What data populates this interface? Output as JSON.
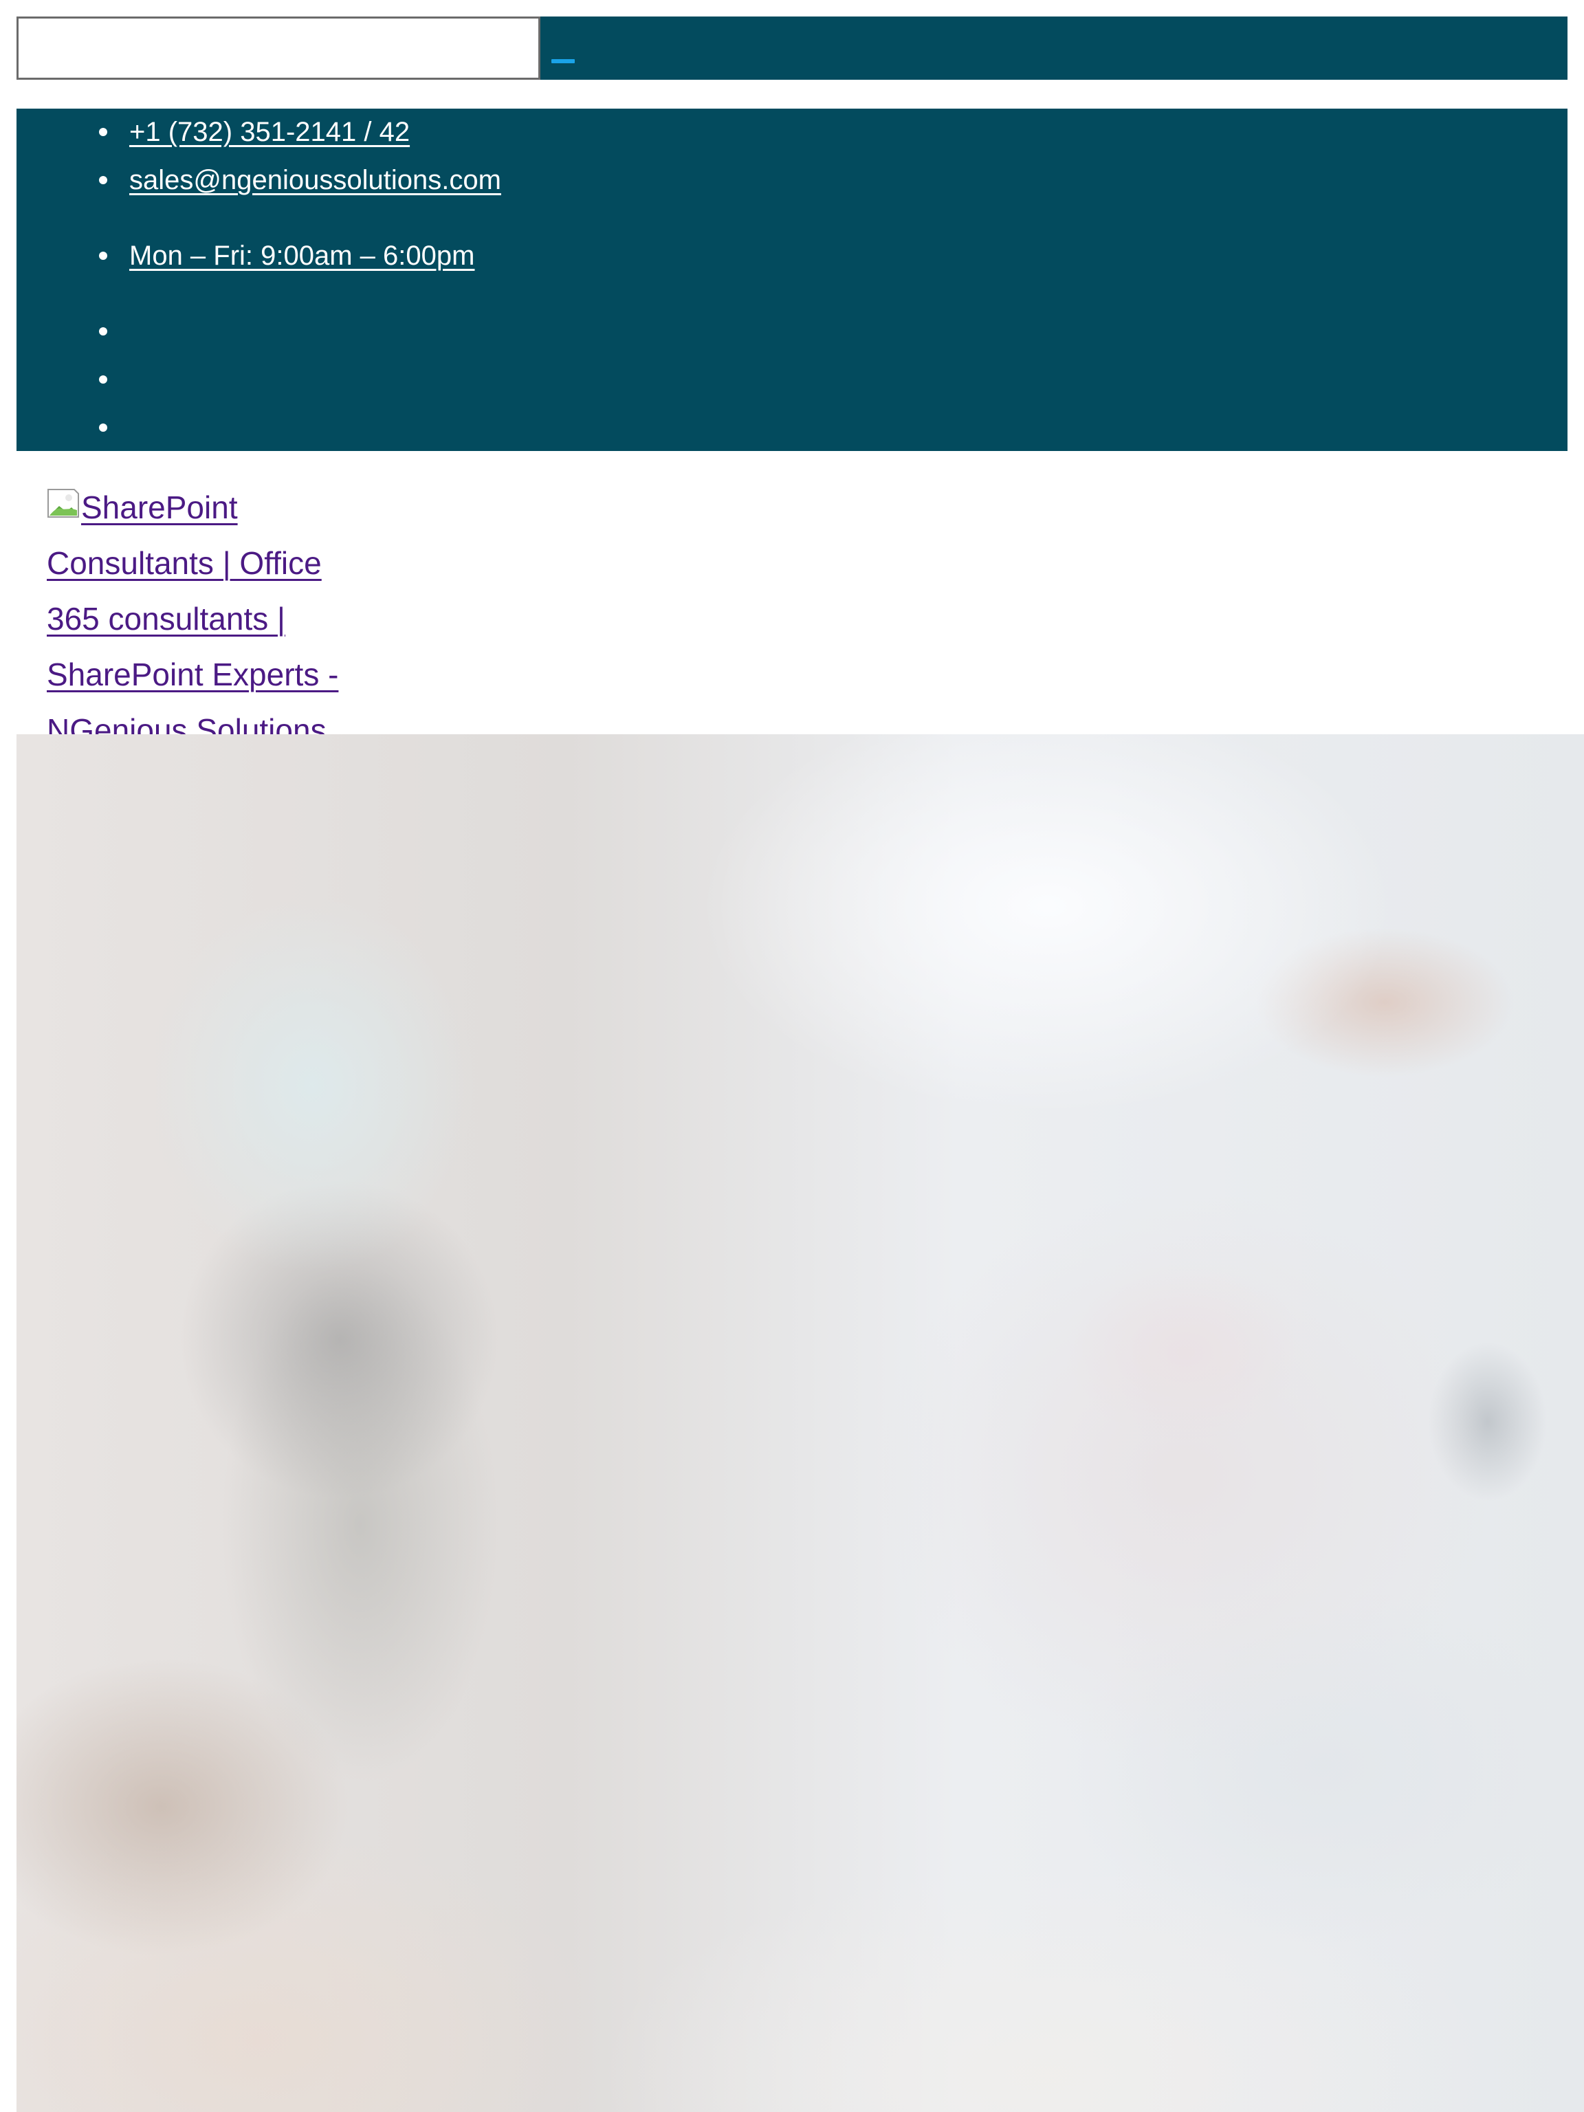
{
  "search": {
    "value": "",
    "placeholder": "",
    "button_label": ""
  },
  "top_bar": {
    "phone": "+1 (732) 351-2141 / 42",
    "email": "sales@ngenioussolutions.com",
    "hours": "Mon – Fri: 9:00am – 6:00pm",
    "social_items": [
      "",
      "",
      ""
    ]
  },
  "logo": {
    "alt_text": "SharePoint Consultants | Office 365 consultants | SharePoint Experts - NGenious Solutions",
    "icon": "broken-image-icon"
  },
  "colors": {
    "header_bg": "#034b5e",
    "link_visited": "#4b1a84",
    "search_accent": "#1aa3e8"
  }
}
